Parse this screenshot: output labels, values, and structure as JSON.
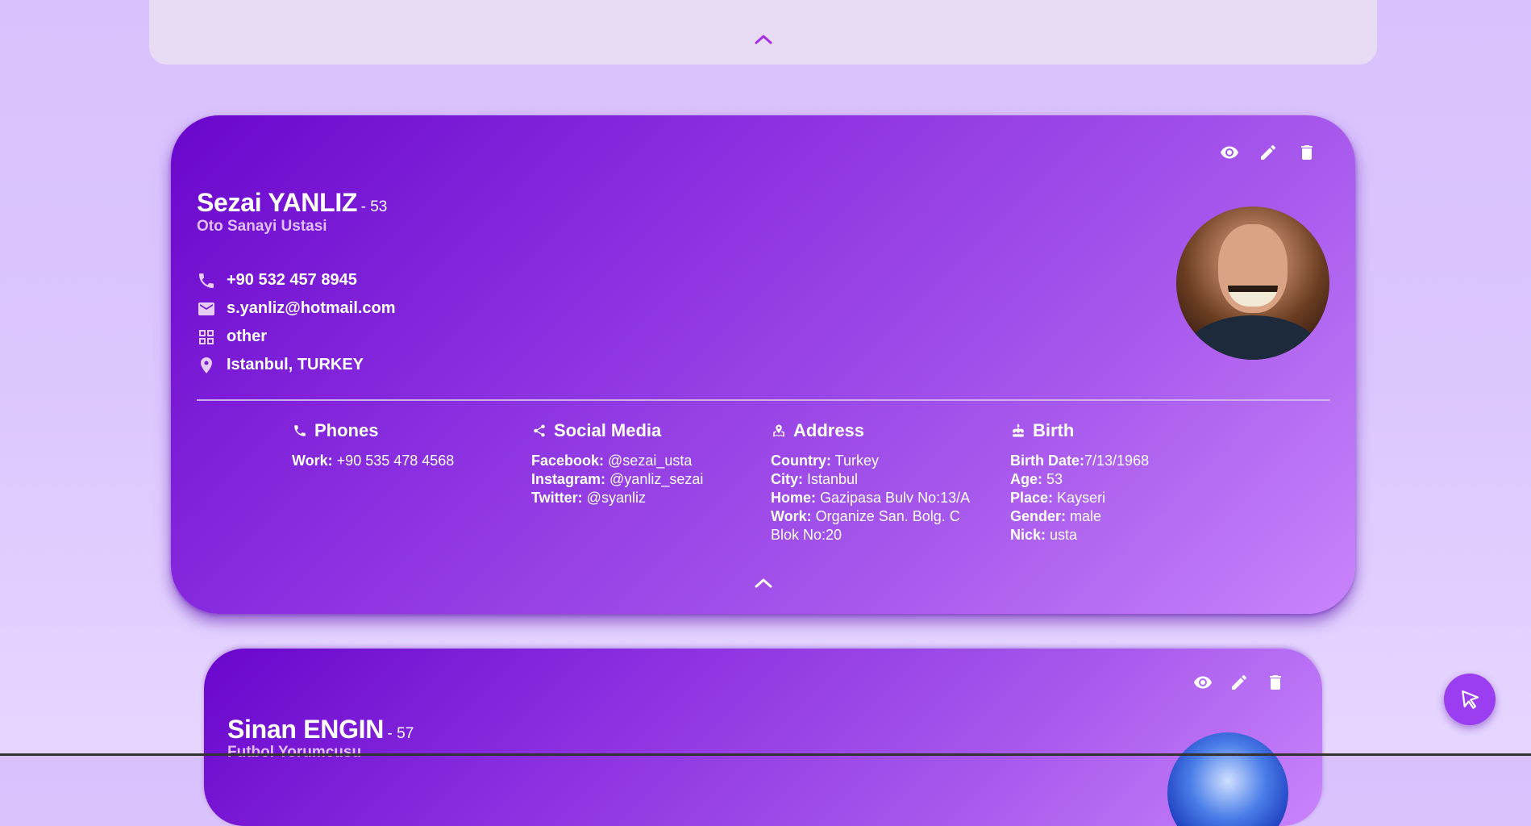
{
  "colors": {
    "accent": "#9b3df0",
    "card_start": "#6a06cc",
    "card_end": "#c884fb",
    "subtitle": "#e0bfff"
  },
  "top_panel": {
    "collapse_icon": "chevron-up-icon"
  },
  "cards": [
    {
      "name": "Sezai YANLIZ",
      "age_suffix": "- 53",
      "title": "Oto Sanayi Ustasi",
      "actions": [
        "eye-icon",
        "pencil-icon",
        "trash-icon"
      ],
      "contacts": {
        "phone": "+90 532 457 8945",
        "email": "s.yanliz@hotmail.com",
        "category": "other",
        "location": "Istanbul, TURKEY"
      },
      "phones": {
        "heading": "Phones",
        "work_label": "Work:",
        "work_value": " +90 535 478 4568"
      },
      "social": {
        "heading": "Social Media",
        "facebook_label": "Facebook:",
        "facebook_value": " @sezai_usta",
        "instagram_label": "Instagram:",
        "instagram_value": " @yanliz_sezai",
        "twitter_label": "Twitter:",
        "twitter_value": " @syanliz"
      },
      "address": {
        "heading": "Address",
        "country_label": "Country:",
        "country_value": " Turkey",
        "city_label": "City:",
        "city_value": " Istanbul",
        "home_label": "Home:",
        "home_value": " Gazipasa Bulv No:13/A",
        "work_label": "Work:",
        "work_value": " Organize San. Bolg. C Blok No:20"
      },
      "birth": {
        "heading": "Birth",
        "date_label": "Birth Date:",
        "date_value": "7/13/1968",
        "age_label": "Age:",
        "age_value": " 53",
        "place_label": "Place:",
        "place_value": " Kayseri",
        "gender_label": "Gender:",
        "gender_value": " male",
        "nick_label": "Nick:",
        "nick_value": " usta"
      }
    },
    {
      "name": "Sinan ENGIN",
      "age_suffix": "- 57",
      "title": "Futbol Yorumcusu",
      "actions": [
        "eye-icon",
        "pencil-icon",
        "trash-icon"
      ]
    }
  ],
  "fab": {
    "icon": "cursor-arrow-icon"
  }
}
